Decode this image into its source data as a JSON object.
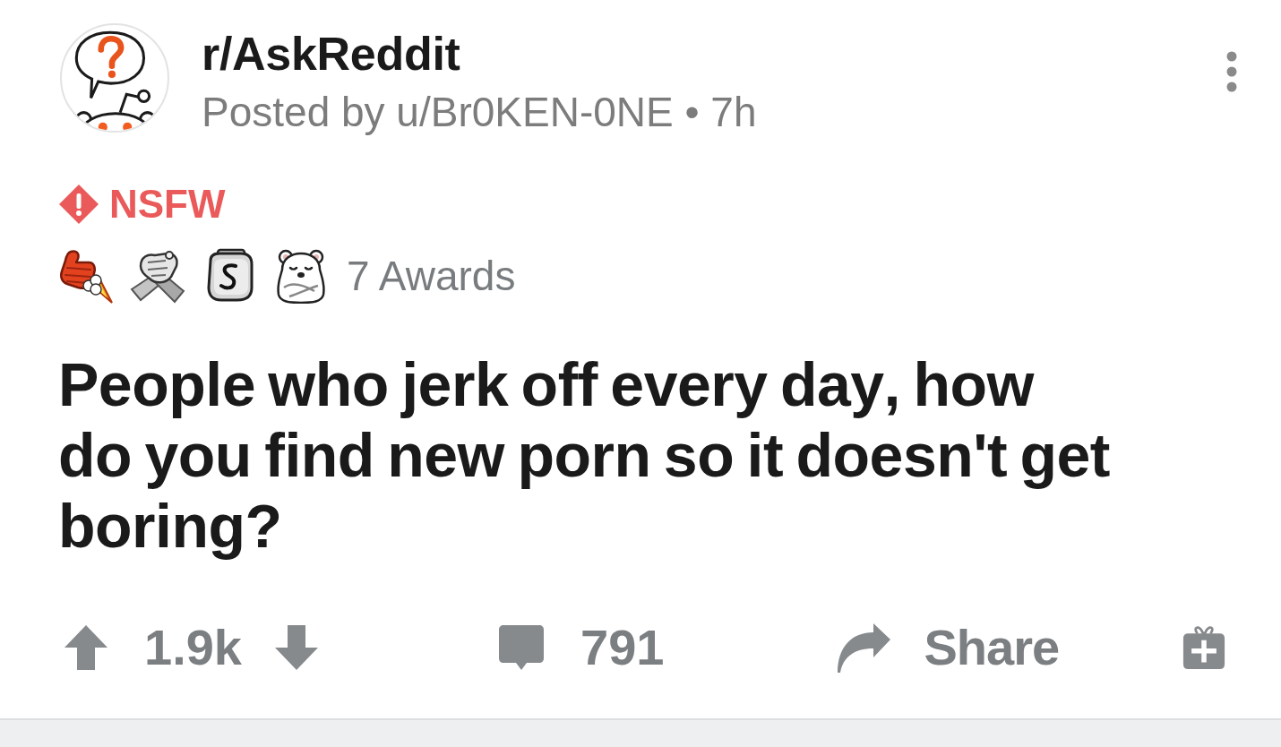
{
  "post": {
    "subreddit": "r/AskReddit",
    "byline": "Posted by u/Br0KEN-0NE • 7h",
    "flair": {
      "label": "NSFW"
    },
    "awards": {
      "icons": [
        {
          "kind": "rocket"
        },
        {
          "kind": "handshake"
        },
        {
          "kind": "coin"
        },
        {
          "kind": "bear"
        }
      ],
      "count_label": "7 Awards"
    },
    "title": "People who jerk off every day, how do you find new porn so it doesn't get boring?",
    "actions": {
      "score": "1.9k",
      "comments": "791",
      "share": "Share"
    }
  }
}
